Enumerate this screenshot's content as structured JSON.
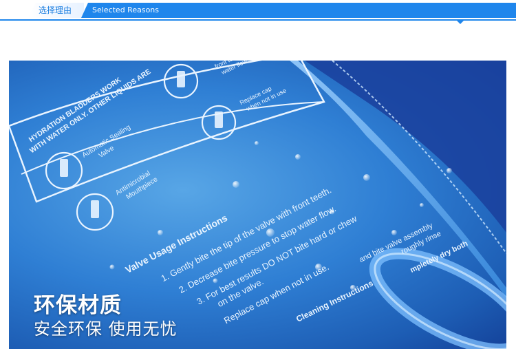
{
  "header": {
    "title_cn": "选择理由",
    "title_en": "Selected  Reasons"
  },
  "package": {
    "warning": [
      "HYDRATION BLADDERS WORK",
      "WITH WATER ONLY. OTHER LIQUIDS ARE"
    ],
    "features": [
      "Automatic Sealing",
      "Valve",
      "Antimicrobial",
      "Mouthpiece"
    ],
    "side_notes": [
      "front teeth",
      "water flow.",
      "Replace cap",
      "when not in use"
    ],
    "valve_heading": "Valve Usage Instructions",
    "steps": [
      "1. Gently bite the tip of the valve with front teeth.",
      "2. Decrease bite pressure to stop water flow.",
      "3. For best results DO NOT bite hard or chew",
      "on the valve.",
      "Replace cap when not in use."
    ],
    "cleaning_heading": "Cleaning Instructions",
    "cleaning_text": [
      "and bite valve assembly",
      "roughly rinse",
      "mpletely dry both"
    ]
  },
  "overlay": {
    "title": "环保材质",
    "subtitle": "安全环保  使用无忧"
  },
  "colors": {
    "brand_blue": "#1f86ec",
    "bottle_blue": "#2f7fd4"
  }
}
